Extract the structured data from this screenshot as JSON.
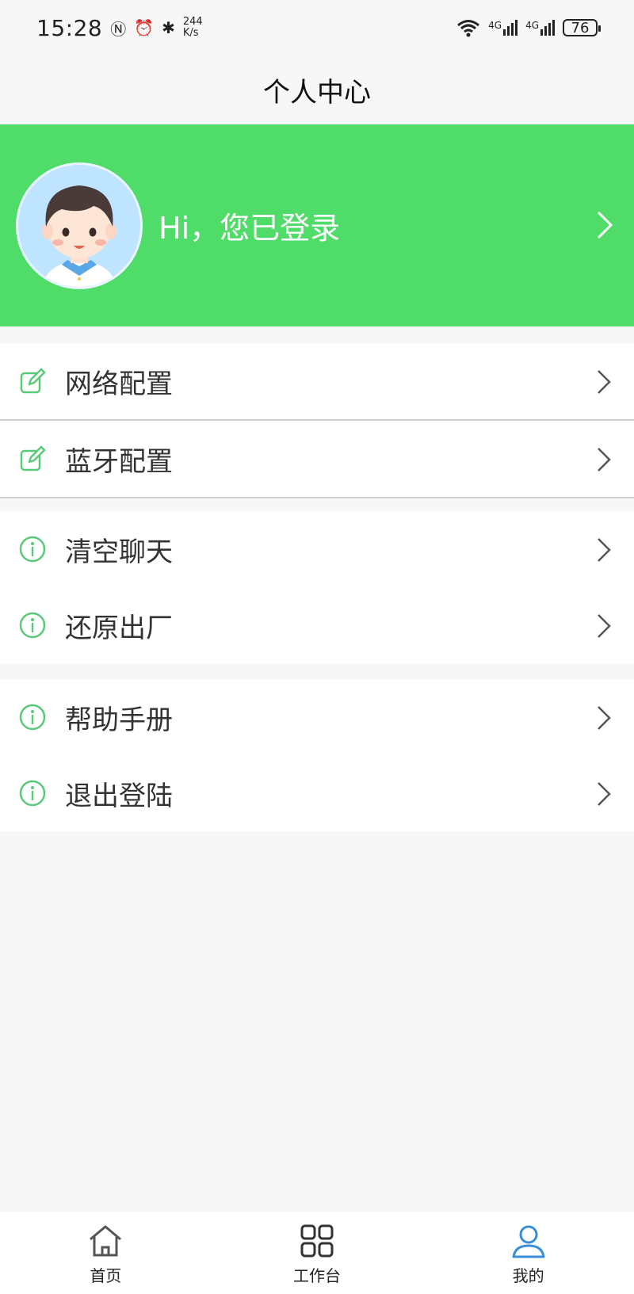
{
  "status_bar": {
    "time": "15:28",
    "net_speed_value": "244",
    "net_speed_unit": "K/s",
    "signal1": "4G",
    "signal2": "4G",
    "battery": "76"
  },
  "header": {
    "title": "个人中心"
  },
  "profile": {
    "greeting": "Hi，您已登录"
  },
  "menu_groups": [
    {
      "items": [
        {
          "label": "网络配置",
          "icon": "edit-icon"
        },
        {
          "label": "蓝牙配置",
          "icon": "edit-icon"
        }
      ]
    },
    {
      "items": [
        {
          "label": "清空聊天",
          "icon": "info-icon"
        },
        {
          "label": "还原出厂",
          "icon": "info-icon"
        }
      ]
    },
    {
      "items": [
        {
          "label": "帮助手册",
          "icon": "info-icon"
        },
        {
          "label": "退出登陆",
          "icon": "info-icon"
        }
      ]
    }
  ],
  "tabs": [
    {
      "label": "首页",
      "icon": "home-icon"
    },
    {
      "label": "工作台",
      "icon": "grid-icon"
    },
    {
      "label": "我的",
      "icon": "user-icon",
      "active": true
    }
  ],
  "colors": {
    "brand_green": "#50dc69",
    "icon_green": "#5cc97a",
    "active_tab": "#3a8ed8"
  }
}
